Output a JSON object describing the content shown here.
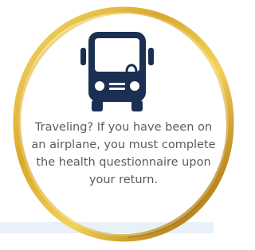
{
  "card": {
    "message": "Traveling? If you have been on an airplane, you must complete the health questionnaire upon your return."
  },
  "icons": {
    "main": "bus-icon",
    "frame": "gold-ring"
  },
  "colors": {
    "gold_light": "#f3d25a",
    "gold_mid": "#d9a82c",
    "gold_dark": "#a9771a",
    "icon_navy": "#1b2f52",
    "text_gray": "#5b5b5b",
    "band_blue": "#e8f1f8"
  }
}
